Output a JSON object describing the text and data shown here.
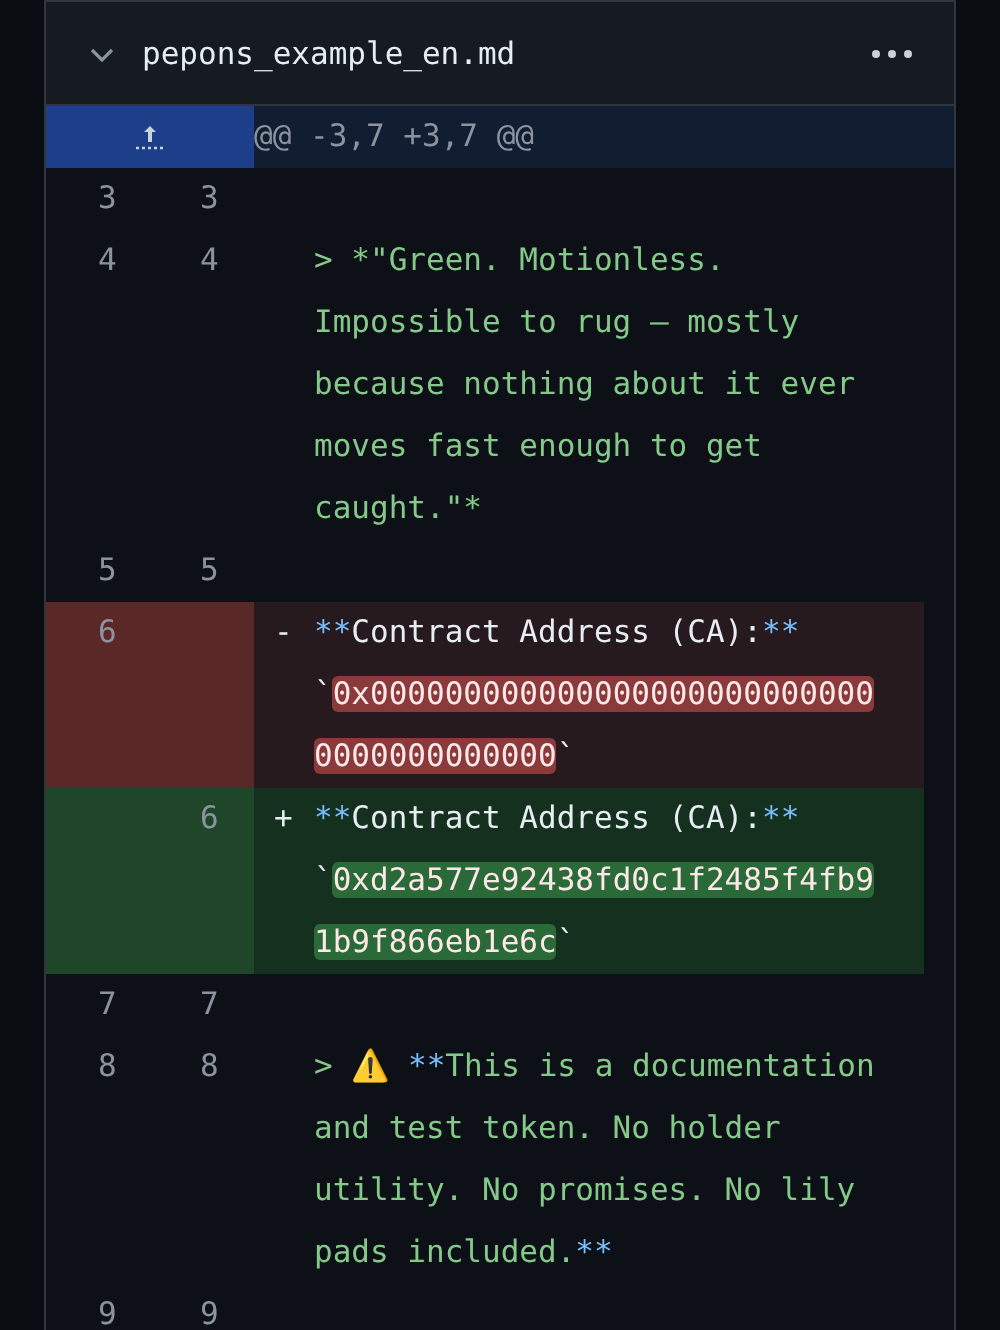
{
  "file": {
    "name": "pepons_example_en.md",
    "expanded": true
  },
  "hunk": {
    "header": "@@ -3,7 +3,7 @@"
  },
  "lines": [
    {
      "kind": "context",
      "old": "3",
      "new": "3"
    },
    {
      "kind": "context",
      "old": "4",
      "new": "4",
      "tokens": [
        {
          "kind": "quote",
          "text": "> *\"Green. Motionless. Impossible to rug — mostly because nothing about it ever moves fast enough to get caught.\"*"
        }
      ]
    },
    {
      "kind": "context",
      "old": "5",
      "new": "5"
    },
    {
      "kind": "deletion",
      "old": "6",
      "sign": "-",
      "tokens": [
        {
          "kind": "syntax",
          "text": "**"
        },
        {
          "kind": "text",
          "text": "Contract Address (CA):"
        },
        {
          "kind": "syntax",
          "text": "**"
        },
        {
          "kind": "text",
          "text": " `"
        },
        {
          "kind": "changed",
          "text": "0x0000000000000000000000000000000000000000"
        },
        {
          "kind": "text",
          "text": "`"
        }
      ]
    },
    {
      "kind": "addition",
      "new": "6",
      "sign": "+",
      "tokens": [
        {
          "kind": "syntax",
          "text": "**"
        },
        {
          "kind": "text",
          "text": "Contract Address (CA):"
        },
        {
          "kind": "syntax",
          "text": "**"
        },
        {
          "kind": "text",
          "text": " `"
        },
        {
          "kind": "changed",
          "text": "0xd2a577e92438fd0c1f2485f4fb91b9f866eb1e6c"
        },
        {
          "kind": "text",
          "text": "`"
        }
      ]
    },
    {
      "kind": "context",
      "old": "7",
      "new": "7"
    },
    {
      "kind": "context",
      "old": "8",
      "new": "8",
      "tokens": [
        {
          "kind": "quote",
          "text": "> "
        },
        {
          "kind": "emoji",
          "text": "⚠️"
        },
        {
          "kind": "syntax",
          "text": " **"
        },
        {
          "kind": "quote",
          "text": "This is a documentation and test token. No holder utility. No promises. No lily pads included."
        },
        {
          "kind": "syntax",
          "text": "**"
        }
      ]
    },
    {
      "kind": "context",
      "old": "9",
      "new": "9"
    }
  ]
}
